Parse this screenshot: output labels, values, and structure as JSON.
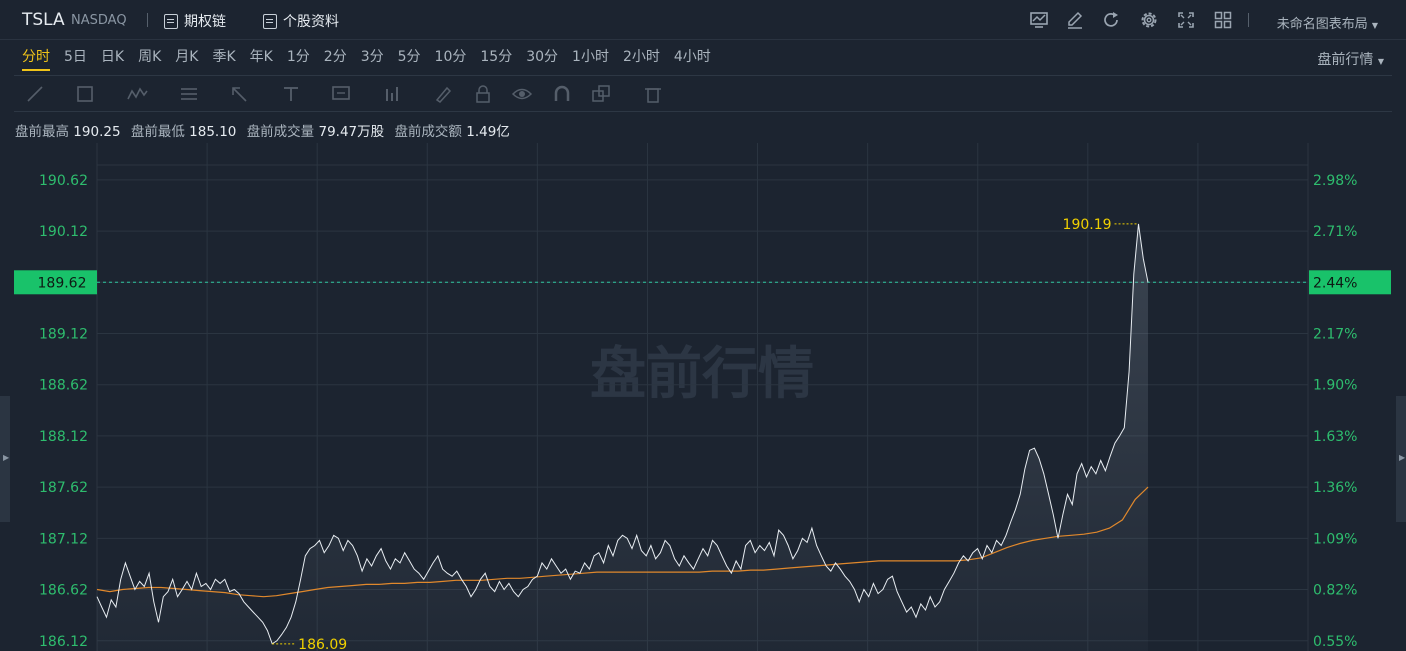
{
  "header": {
    "symbol": "TSLA",
    "exchange": "NASDAQ",
    "links": [
      {
        "label": "期权链",
        "icon": "option-chain-icon"
      },
      {
        "label": "个股资料",
        "icon": "document-icon"
      }
    ],
    "toolbar_icons": [
      "chart-monitor-icon",
      "pen-edit-icon",
      "refresh-icon",
      "gear-icon",
      "fullscreen-icon",
      "grid-layout-icon"
    ],
    "layout_label": "未命名图表布局"
  },
  "period_tabs": [
    "分时",
    "5日",
    "日K",
    "周K",
    "月K",
    "季K",
    "年K",
    "1分",
    "2分",
    "3分",
    "5分",
    "10分",
    "15分",
    "30分",
    "1小时",
    "2小时",
    "4小时"
  ],
  "active_tab": "分时",
  "session_label": "盘前行情",
  "drawing_tools": [
    "line-tool-icon",
    "rectangle-tool-icon",
    "wave-tool-icon",
    "fibonacci-tool-icon",
    "arrow-tool-icon",
    "text-tool-icon",
    "callout-tool-icon",
    "bar-tool-icon",
    "brush-icon",
    "lock-icon",
    "eye-icon",
    "magnet-icon",
    "copy-icon",
    "trash-icon"
  ],
  "stats": {
    "high_label": "盘前最高",
    "high_value": "190.25",
    "low_label": "盘前最低",
    "low_value": "185.10",
    "volume_label": "盘前成交量",
    "volume_value": "79.47万股",
    "turnover_label": "盘前成交额",
    "turnover_value": "1.49亿"
  },
  "colors": {
    "background": "#1c2430",
    "price_line": "#e8edf2",
    "avg_line": "#e0882c",
    "axis_text": "#2ebd6e",
    "current_badge": "#19c26a",
    "marker_text": "#f0d000",
    "active_tab": "#f0c419"
  },
  "chart_data": {
    "type": "line",
    "watermark": "盘前行情",
    "y_ticks": [
      "190.62",
      "190.12",
      "189.62",
      "189.12",
      "188.62",
      "188.12",
      "187.62",
      "187.12",
      "186.62",
      "186.12"
    ],
    "pct_ticks": [
      "2.98%",
      "2.71%",
      "2.44%",
      "2.17%",
      "1.90%",
      "1.63%",
      "1.36%",
      "1.09%",
      "0.82%",
      "0.55%"
    ],
    "ylim": [
      186.02,
      190.98
    ],
    "current_price": "189.62",
    "current_pct": "2.44%",
    "max_marker": "190.19",
    "min_marker": "186.09",
    "series": [
      {
        "role": "price",
        "values": [
          186.55,
          186.45,
          186.35,
          186.52,
          186.45,
          186.72,
          186.88,
          186.75,
          186.62,
          186.7,
          186.65,
          186.78,
          186.5,
          186.3,
          186.55,
          186.6,
          186.72,
          186.55,
          186.62,
          186.7,
          186.62,
          186.78,
          186.65,
          186.68,
          186.62,
          186.72,
          186.68,
          186.72,
          186.6,
          186.62,
          186.58,
          186.5,
          186.45,
          186.4,
          186.35,
          186.3,
          186.22,
          186.09,
          186.12,
          186.18,
          186.25,
          186.35,
          186.5,
          186.72,
          186.95,
          187.02,
          187.05,
          187.1,
          186.98,
          187.05,
          187.15,
          187.12,
          187.0,
          187.1,
          187.05,
          186.95,
          186.8,
          186.92,
          186.85,
          186.95,
          187.02,
          186.9,
          186.82,
          186.92,
          186.88,
          186.98,
          186.9,
          186.82,
          186.78,
          186.72,
          186.8,
          186.88,
          186.95,
          186.82,
          186.78,
          186.75,
          186.8,
          186.72,
          186.65,
          186.55,
          186.62,
          186.72,
          186.78,
          186.65,
          186.6,
          186.7,
          186.62,
          186.68,
          186.6,
          186.55,
          186.62,
          186.65,
          186.72,
          186.75,
          186.88,
          186.82,
          186.92,
          186.85,
          186.78,
          186.82,
          186.72,
          186.8,
          186.78,
          186.88,
          186.82,
          186.95,
          186.98,
          186.88,
          187.05,
          186.95,
          187.1,
          187.15,
          187.12,
          187.02,
          187.15,
          187.0,
          186.95,
          187.05,
          186.92,
          186.98,
          187.1,
          187.05,
          186.92,
          186.85,
          186.95,
          186.88,
          186.82,
          186.92,
          187.02,
          186.95,
          187.1,
          187.05,
          186.95,
          186.85,
          186.78,
          186.9,
          186.82,
          187.05,
          187.1,
          186.98,
          187.05,
          187.0,
          187.08,
          186.95,
          187.2,
          187.15,
          187.05,
          186.92,
          187.0,
          187.12,
          187.08,
          187.22,
          187.05,
          186.95,
          186.85,
          186.8,
          186.88,
          186.82,
          186.75,
          186.7,
          186.62,
          186.5,
          186.62,
          186.55,
          186.68,
          186.58,
          186.62,
          186.72,
          186.75,
          186.6,
          186.5,
          186.4,
          186.45,
          186.35,
          186.48,
          186.42,
          186.55,
          186.45,
          186.5,
          186.62,
          186.7,
          186.78,
          186.88,
          186.95,
          186.9,
          186.98,
          187.02,
          186.92,
          187.05,
          186.98,
          187.1,
          187.05,
          187.15,
          187.28,
          187.4,
          187.55,
          187.8,
          187.98,
          188.0,
          187.9,
          187.75,
          187.55,
          187.35,
          187.12,
          187.35,
          187.55,
          187.45,
          187.75,
          187.85,
          187.72,
          187.82,
          187.75,
          187.88,
          187.78,
          187.92,
          188.05,
          188.12,
          188.2,
          188.75,
          189.7,
          190.19,
          189.85,
          189.62
        ]
      },
      {
        "role": "average",
        "values": [
          186.62,
          186.6,
          186.62,
          186.63,
          186.64,
          186.64,
          186.63,
          186.62,
          186.61,
          186.6,
          186.59,
          186.57,
          186.56,
          186.55,
          186.56,
          186.58,
          186.6,
          186.62,
          186.64,
          186.65,
          186.66,
          186.67,
          186.67,
          186.68,
          186.68,
          186.69,
          186.69,
          186.7,
          186.71,
          186.71,
          186.71,
          186.72,
          186.73,
          186.73,
          186.74,
          186.75,
          186.76,
          186.77,
          186.78,
          186.79,
          186.79,
          186.79,
          186.79,
          186.79,
          186.79,
          186.79,
          186.79,
          186.79,
          186.8,
          186.8,
          186.8,
          186.81,
          186.81,
          186.82,
          186.83,
          186.84,
          186.85,
          186.86,
          186.87,
          186.88,
          186.89,
          186.9,
          186.9,
          186.9,
          186.9,
          186.9,
          186.9,
          186.9,
          186.91,
          186.93,
          186.98,
          187.03,
          187.07,
          187.1,
          187.12,
          187.14,
          187.15,
          187.16,
          187.18,
          187.22,
          187.3,
          187.5,
          187.62
        ]
      }
    ]
  }
}
